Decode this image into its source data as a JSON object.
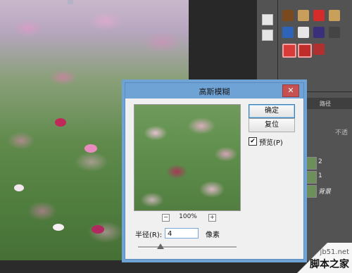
{
  "dialog": {
    "title": "高斯模糊",
    "close_label": "✕",
    "ok_label": "确定",
    "reset_label": "复位",
    "preview_label": "预览(P)",
    "preview_checked": "✔",
    "zoom_minus": "−",
    "zoom_plus": "+",
    "zoom_value": "100%",
    "radius_label": "半径(R):",
    "radius_value": "4",
    "radius_unit": "像素"
  },
  "layers": {
    "tab_label": "路径",
    "rows": [
      {
        "label": "2"
      },
      {
        "label": "1"
      },
      {
        "label": "背景"
      }
    ],
    "opacity_hint": "不透"
  },
  "watermark": {
    "url": "jb51.net",
    "name": "脚本之家"
  },
  "colors": {
    "dialog_title_bar": "#6fa3d6",
    "close_button": "#c75050",
    "panel_bg": "#535353"
  }
}
